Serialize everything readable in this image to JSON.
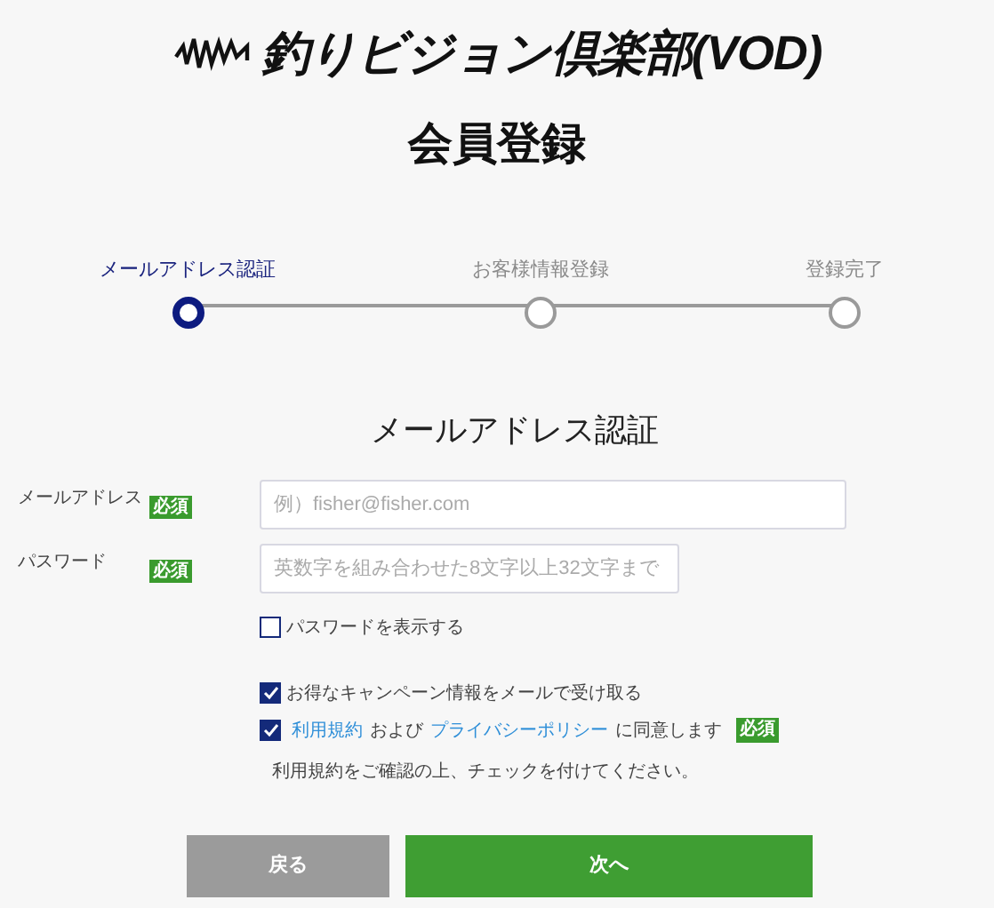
{
  "header": {
    "logo_text": "釣りビジョン倶楽部(VOD)",
    "title": "会員登録"
  },
  "steps": [
    {
      "label": "メールアドレス認証",
      "selected": true
    },
    {
      "label": "お客様情報登録",
      "selected": false
    },
    {
      "label": "登録完了",
      "selected": false
    }
  ],
  "section_title": "メールアドレス認証",
  "fields": [
    {
      "label": "メールアドレス",
      "badge": "必須",
      "placeholder": "例）fisher@fisher.com",
      "kind": "email"
    },
    {
      "label": "パスワード",
      "badge": "必須",
      "placeholder": "英数字を組み合わせた8文字以上32文字まで",
      "kind": "password"
    }
  ],
  "show_password": {
    "label": "パスワードを表示する",
    "checked": false
  },
  "campaign": {
    "label": "お得なキャンペーン情報をメールで受け取る",
    "checked": true
  },
  "terms": {
    "checked": true,
    "link_1": "利用規約",
    "text_1": "および",
    "link_2": "プライバシーポリシー",
    "text_2": "に同意します",
    "badge": "必須"
  },
  "note": "利用規約をご確認の上、チェックを付けてください。",
  "buttons": [
    {
      "label": "戻る",
      "kind": "back"
    },
    {
      "label": "次へ",
      "kind": "next"
    }
  ]
}
